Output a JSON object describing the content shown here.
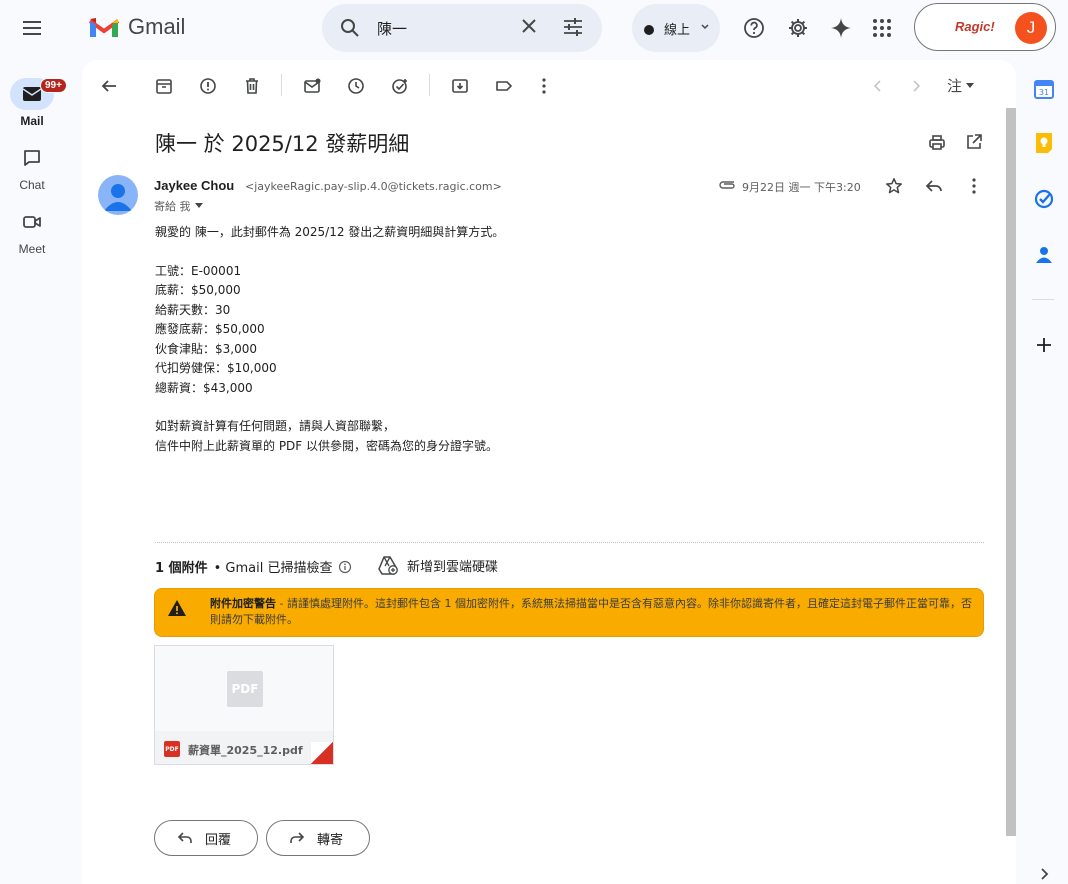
{
  "app": {
    "name": "Gmail"
  },
  "search": {
    "value": "陳一"
  },
  "status": {
    "label": "線上"
  },
  "account": {
    "org": "Ragic!",
    "initial": "J"
  },
  "nav": {
    "mail": {
      "label": "Mail",
      "badge": "99+"
    },
    "chat": {
      "label": "Chat"
    },
    "meet": {
      "label": "Meet"
    }
  },
  "toolbar": {
    "language": "注"
  },
  "email": {
    "subject": "陳一 於 2025/12 發薪明細",
    "sender_name": "Jaykee Chou",
    "sender_email": "<jaykeeRagic.pay-slip.4.0@tickets.ragic.com>",
    "to": "寄給 我",
    "date": "9月22日 週一 下午3:20",
    "greeting": "親愛的 陳一，此封郵件為 2025/12 發出之薪資明細與計算方式。",
    "lines": [
      "工號：E-00001",
      "底薪：$50,000",
      "給薪天數：30",
      "應發底薪：$50,000",
      "伙食津貼：$3,000",
      "代扣勞健保：$10,000",
      "總薪資：$43,000"
    ],
    "closing1": "如對薪資計算有任何問題，請與人資部聯繫，",
    "closing2": "信件中附上此薪資單的 PDF 以供參閱，密碼為您的身分證字號。"
  },
  "attachments": {
    "count_label": "1 個附件",
    "scan_label": "• Gmail 已掃描檢查",
    "add_drive": "新增到雲端硬碟",
    "warning_title": "附件加密警告",
    "warning_body": " - 請謹慎處理附件。這封郵件包含 1 個加密附件，系統無法掃描當中是否含有惡意內容。除非你認識寄件者，且確定這封電子郵件正當可靠，否則請勿下載附件。",
    "preview_label": "PDF",
    "file_name": "薪資單_2025_12.pdf",
    "file_badge": "PDF"
  },
  "actions": {
    "reply": "回覆",
    "forward": "轉寄"
  },
  "colors": {
    "warning": "#f9ab00",
    "accent": "#0b57d0",
    "avatar": "#f4511e"
  }
}
